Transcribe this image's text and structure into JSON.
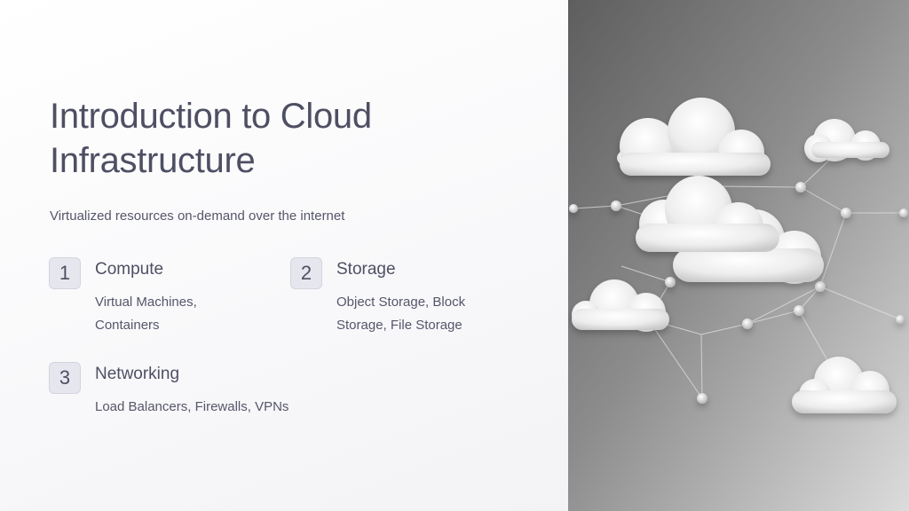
{
  "slide": {
    "title": "Introduction to Cloud Infrastructure",
    "subtitle": "Virtualized resources on-demand over the internet",
    "features": [
      {
        "number": "1",
        "title": "Compute",
        "description": "Virtual Machines, Containers"
      },
      {
        "number": "2",
        "title": "Storage",
        "description": "Object Storage, Block Storage, File Storage"
      },
      {
        "number": "3",
        "title": "Networking",
        "description": "Load Balancers, Firewalls, VPNs"
      }
    ]
  },
  "image": {
    "subject": "cloud-network-illustration"
  }
}
